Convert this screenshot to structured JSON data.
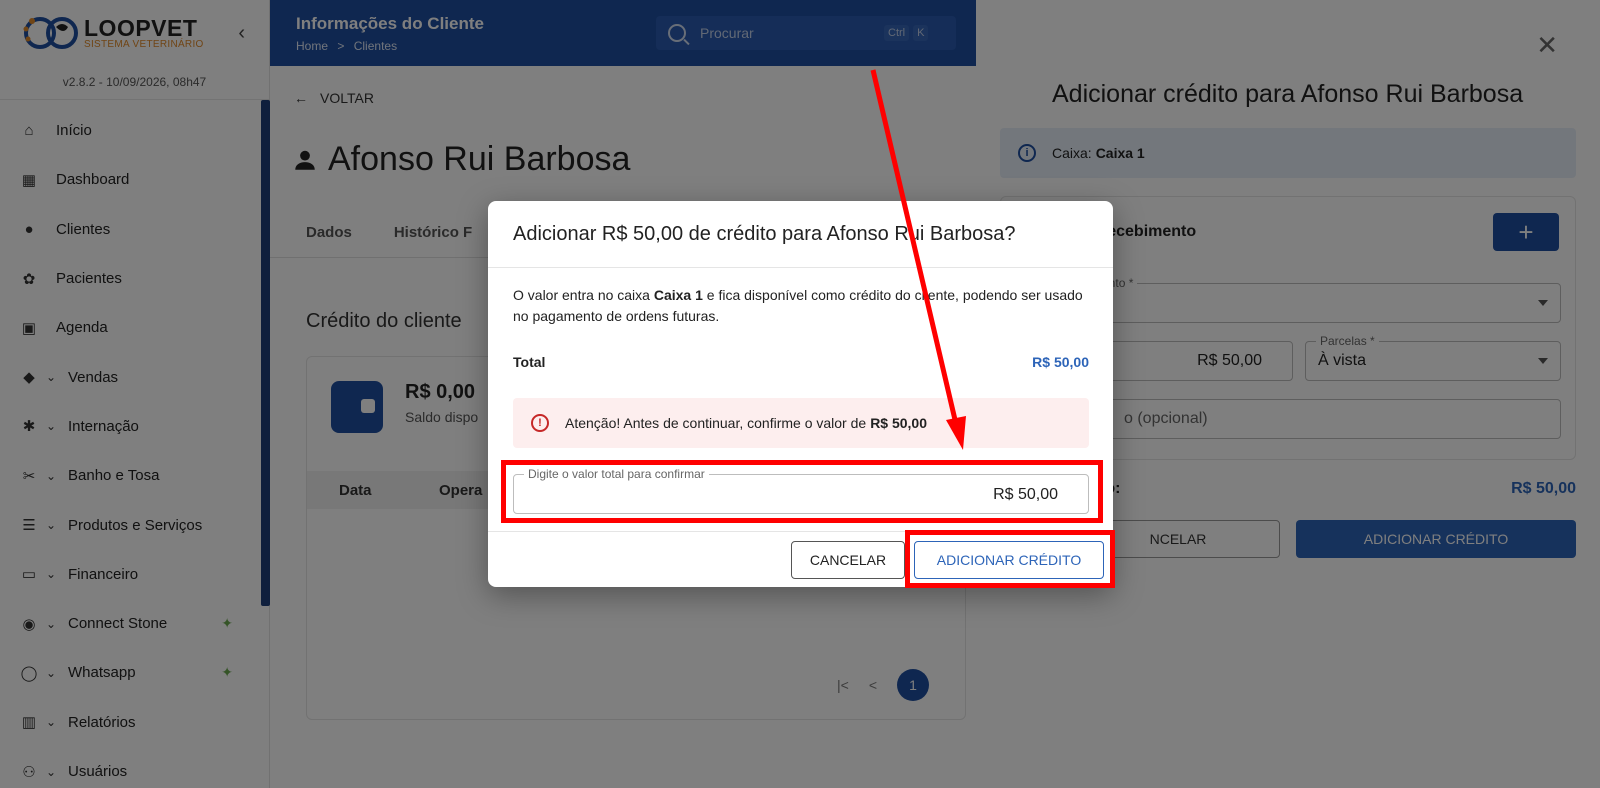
{
  "sidebar": {
    "logo_big": "LOOPVET",
    "logo_small": "SISTEMA VETERINÁRIO",
    "version": "v2.8.2 - 10/09/2026, 08h47",
    "items": [
      {
        "label": "Início",
        "icon": "home-icon",
        "chevron": false
      },
      {
        "label": "Dashboard",
        "icon": "dashboard-icon",
        "chevron": false
      },
      {
        "label": "Clientes",
        "icon": "person-icon",
        "chevron": false
      },
      {
        "label": "Pacientes",
        "icon": "paw-icon",
        "chevron": false
      },
      {
        "label": "Agenda",
        "icon": "calendar-icon",
        "chevron": false
      },
      {
        "label": "Vendas",
        "icon": "tag-icon",
        "chevron": true
      },
      {
        "label": "Internação",
        "icon": "asterisk-icon",
        "chevron": true
      },
      {
        "label": "Banho e Tosa",
        "icon": "scissors-icon",
        "chevron": true
      },
      {
        "label": "Produtos e Serviços",
        "icon": "list-icon",
        "chevron": true
      },
      {
        "label": "Financeiro",
        "icon": "money-icon",
        "chevron": true
      },
      {
        "label": "Connect Stone",
        "icon": "nfc-icon",
        "chevron": true,
        "spark": true
      },
      {
        "label": "Whatsapp",
        "icon": "whatsapp-icon",
        "chevron": true,
        "spark": true
      },
      {
        "label": "Relatórios",
        "icon": "chart-icon",
        "chevron": true
      },
      {
        "label": "Usuários",
        "icon": "users-icon",
        "chevron": true
      }
    ]
  },
  "topbar": {
    "title": "Informações do Cliente",
    "breadcrumb_home": "Home",
    "breadcrumb_sep": ">",
    "breadcrumb_current": "Clientes",
    "search_placeholder": "Procurar",
    "kbd1": "Ctrl",
    "kbd2": "K"
  },
  "main": {
    "back_label": "VOLTAR",
    "client_name": "Afonso Rui Barbosa",
    "tabs": [
      "Dados",
      "Histórico F"
    ],
    "section_title": "Crédito do cliente",
    "balance": "R$ 0,00",
    "balance_sub": "Saldo dispo",
    "table_headers": [
      "Data",
      "Opera"
    ],
    "pager_first": "|<",
    "pager_prev": "<",
    "pager_current": "1"
  },
  "drawer": {
    "title": "Adicionar crédito para Afonso Rui Barbosa",
    "info_label": "Caixa:",
    "info_value": "Caixa 1",
    "section_header": "recebimento",
    "plus": "+",
    "field1_label": "ebimento *",
    "field2_value": "R$ 50,00",
    "field3_label": "Parcelas *",
    "field3_value": "À vista",
    "field4_placeholder": "o (opcional)",
    "total_label": "to:",
    "total_value": "R$ 50,00",
    "cancel_label": "NCELAR",
    "add_label": "ADICIONAR CRÉDITO"
  },
  "modal": {
    "title": "Adicionar R$ 50,00 de crédito para Afonso Rui Barbosa?",
    "desc_1": "O valor entra no caixa ",
    "desc_caixa": "Caixa 1",
    "desc_2": " e fica disponível como crédito do cliente, podendo ser usado no pagamento de ordens futuras.",
    "total_label": "Total",
    "total_value": "R$ 50,00",
    "alert_text": "Atenção! Antes de continuar, confirme o valor de ",
    "alert_value": "R$ 50,00",
    "input_label": "Digite o valor total para confirmar",
    "input_value": "R$ 50,00",
    "cancel_label": "CANCELAR",
    "add_label": "ADICIONAR CRÉDITO"
  },
  "colors": {
    "primary": "#1f4fa0",
    "accent_blue": "#2d64b8",
    "highlight": "#ff0000",
    "alert_bg": "#fdeeee",
    "alert_icon": "#c62828"
  }
}
